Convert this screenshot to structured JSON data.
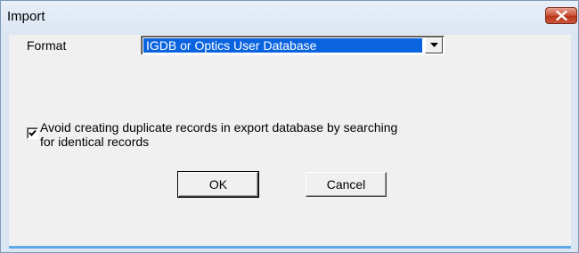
{
  "window": {
    "title": "Import"
  },
  "form": {
    "format_label": "Format",
    "format_value": "IGDB or Optics User Database"
  },
  "options": {
    "avoid_duplicates": {
      "checked": true,
      "label_line1": "Avoid creating duplicate records in export database by searching",
      "label_line2": "for identical records"
    }
  },
  "buttons": {
    "ok": "OK",
    "cancel": "Cancel"
  },
  "icons": {
    "close": "close-icon",
    "dropdown": "chevron-down-icon",
    "check": "checkmark-icon"
  },
  "colors": {
    "title_bg": "#dbe6f3",
    "client_bg": "#f0f0f0",
    "selection": "#0a64e0",
    "close_button": "#c9553a"
  }
}
